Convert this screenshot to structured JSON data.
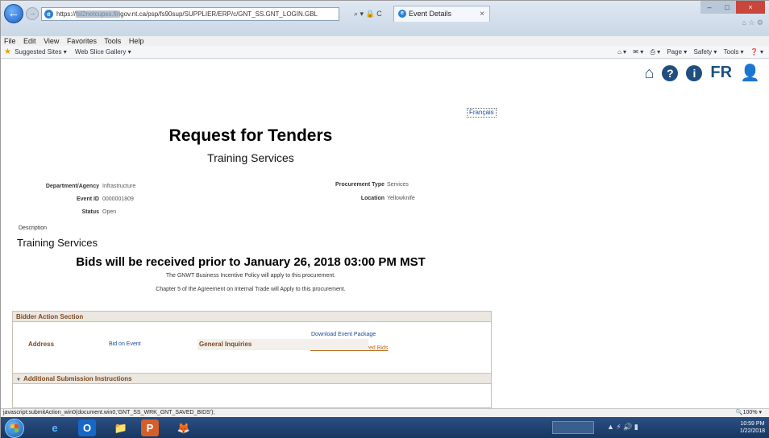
{
  "browser": {
    "address_prefix": "https://",
    "address_blurred": "fsl2netcupss.fin",
    "address_domain": "gov.nt.ca",
    "address_path": "/psp/fs90sup/SUPPLIER/ERP/c/GNT_SS.GNT_LOGIN.GBL",
    "addr_tools": "⌕ ▾ 🔒 C",
    "tab_title": "Event Details",
    "tab_close": "×",
    "menu": [
      "File",
      "Edit",
      "View",
      "Favorites",
      "Tools",
      "Help"
    ],
    "favorites": [
      "Suggested Sites ▾",
      "Web Slice Gallery ▾"
    ],
    "command_bar": [
      "⌂ ▾",
      "✉ ▾",
      "⎙ ▾",
      "Page ▾",
      "Safety ▾",
      "Tools ▾",
      "❓ ▾"
    ],
    "status_text": "javascript:submitAction_win0(document.win0,'GNT_SS_WRK_GNT_SAVED_BIDS');",
    "zoom": "🔍100% ▾"
  },
  "header_icons": {
    "home": "⌂",
    "help": "?",
    "info": "i",
    "language": "FR",
    "user": "👤"
  },
  "page": {
    "francais_link": "Français",
    "title": "Request for Tenders",
    "subtitle": "Training Services",
    "fields": {
      "dept_label": "Department/Agency",
      "dept_value": "Infrastructure",
      "event_label": "Event ID",
      "event_value": "0000001809",
      "status_label": "Status",
      "status_value": "Open",
      "proc_label": "Procurement Type",
      "proc_value": "Services",
      "loc_label": "Location",
      "loc_value": "Yellowknife"
    },
    "description_label": "Description",
    "description_value": "Training Services",
    "deadline": "Bids will be received prior to January 26, 2018 03:00 PM MST",
    "policy_1": "The GNWT Business Incentive Policy will apply to this procurement.",
    "policy_2": "Chapter 5 of the Agreement on Internal Trade will Apply to this procurement.",
    "bidder_section": {
      "header": "Bidder Action Section",
      "bid_on_event": "Bid on Event",
      "download_package": "Download Event Package",
      "view_saved_bids": "View, Edit, or Copy Saved Bids"
    },
    "additional_section": {
      "header": "Additional Submission Instructions",
      "address_header": "Address",
      "inquiries_header": "General Inquiries"
    }
  },
  "taskbar": {
    "apps": [
      "e",
      "O",
      "📁",
      "P",
      "🦊"
    ],
    "tray": "▲ ⚡ 🔊 ▮",
    "time": "10:59 PM",
    "date": "1/22/2018"
  },
  "colors": {
    "accent_blue": "#1e4f7f",
    "section_header_text": "#7a4a22",
    "link_blue": "#1a4a9a"
  }
}
